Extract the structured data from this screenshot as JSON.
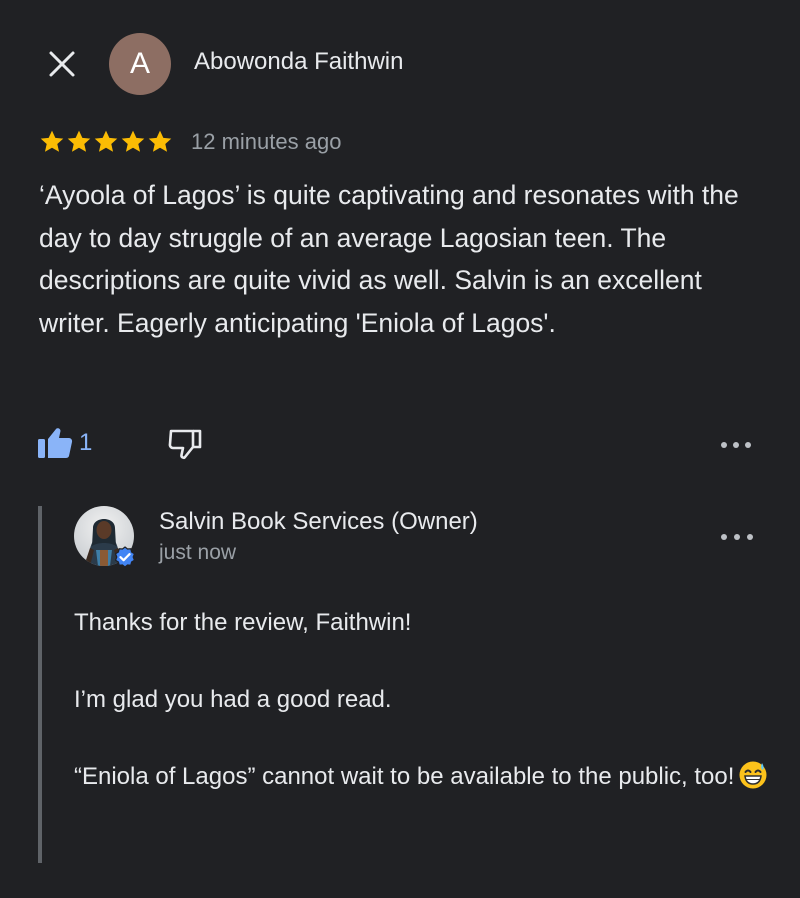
{
  "review": {
    "reviewer_initial": "A",
    "reviewer_name": "Abowonda Faithwin",
    "avatar_color": "#8d6e63",
    "rating": 5,
    "time_ago": "12 minutes ago",
    "text": "‘Ayoola of Lagos’ is quite captivating and resonates with the day to day struggle of an average Lagosian teen. The descriptions are quite vivid as well. Salvin is an excellent writer. Eagerly anticipating 'Eniola of Lagos'.",
    "like_count": "1"
  },
  "icons": {
    "close": "close-icon",
    "star": "star-icon",
    "like": "thumbs-up-icon",
    "dislike": "thumbs-down-icon",
    "more": "more-horizontal-icon",
    "verified": "verified-check-icon",
    "emoji": "grinning-sweat-emoji"
  },
  "reply": {
    "owner_name": "Salvin Book Services (Owner)",
    "time": "just now",
    "lines": [
      "Thanks for the review, Faithwin!",
      "I’m glad you had a good read.",
      "“Eniola of Lagos” cannot wait to be available to the public, too!"
    ]
  },
  "colors": {
    "background": "#202124",
    "star": "#fbbc04",
    "like_accent": "#8ab4f8",
    "verified": "#4285f4",
    "secondary_text": "#9aa0a6"
  }
}
